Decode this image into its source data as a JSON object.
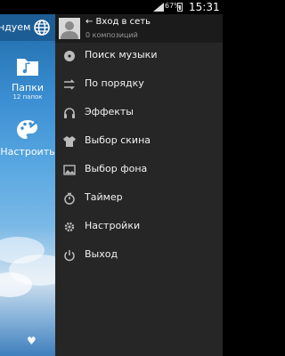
{
  "status_bar": {
    "battery_percent": "67%",
    "time": "15:31"
  },
  "background_app": {
    "title_fragment": "ндуем",
    "tiles": [
      {
        "label": "Папки",
        "sublabel": "12 папок"
      },
      {
        "label": "Настроить",
        "sublabel": ""
      }
    ]
  },
  "drawer": {
    "header": {
      "login_label": "← Вход в сеть",
      "compositions_count": "0 композиций"
    },
    "menu": [
      {
        "label": "Поиск музыки",
        "icon": "music-disc-icon"
      },
      {
        "label": "По порядку",
        "icon": "order-arrows-icon"
      },
      {
        "label": "Эффекты",
        "icon": "headphones-icon"
      },
      {
        "label": "Выбор скина",
        "icon": "tshirt-icon"
      },
      {
        "label": "Выбор фона",
        "icon": "image-icon"
      },
      {
        "label": "Таймер",
        "icon": "timer-icon"
      },
      {
        "label": "Настройки",
        "icon": "gear-icon"
      },
      {
        "label": "Выход",
        "icon": "power-icon"
      }
    ]
  }
}
